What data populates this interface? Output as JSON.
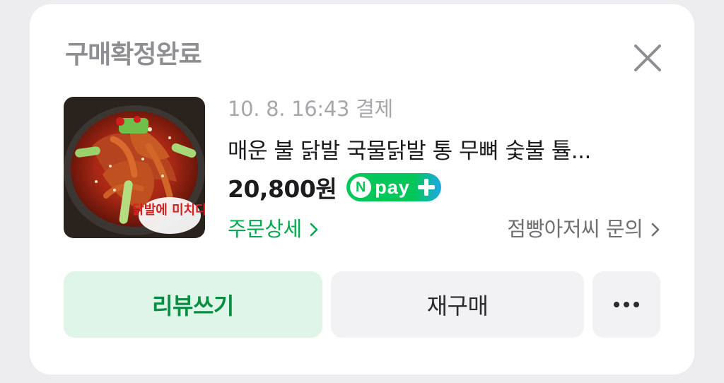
{
  "card": {
    "status_title": "구매확정완료",
    "close_icon": "close-icon"
  },
  "order": {
    "meta": "10. 8. 16:43 결제",
    "product_name": "매운 불 닭발 국물닭발 통 무뼈 숯불 튤...",
    "price": "20,800원",
    "thumbnail_logo_text": "닭발에 미치다",
    "npay": {
      "n_letter": "N",
      "label": "pay",
      "green": "#03c75a",
      "blue": "#1ea7e8"
    }
  },
  "links": {
    "order_detail": "주문상세",
    "seller_inquiry": "점빵아저씨 문의"
  },
  "buttons": {
    "review": "리뷰쓰기",
    "rebuy": "재구매",
    "more_icon": "more-dots-icon"
  },
  "colors": {
    "accent_green": "#03a94f",
    "review_bg": "#def5e8",
    "muted": "#8e8e93"
  }
}
